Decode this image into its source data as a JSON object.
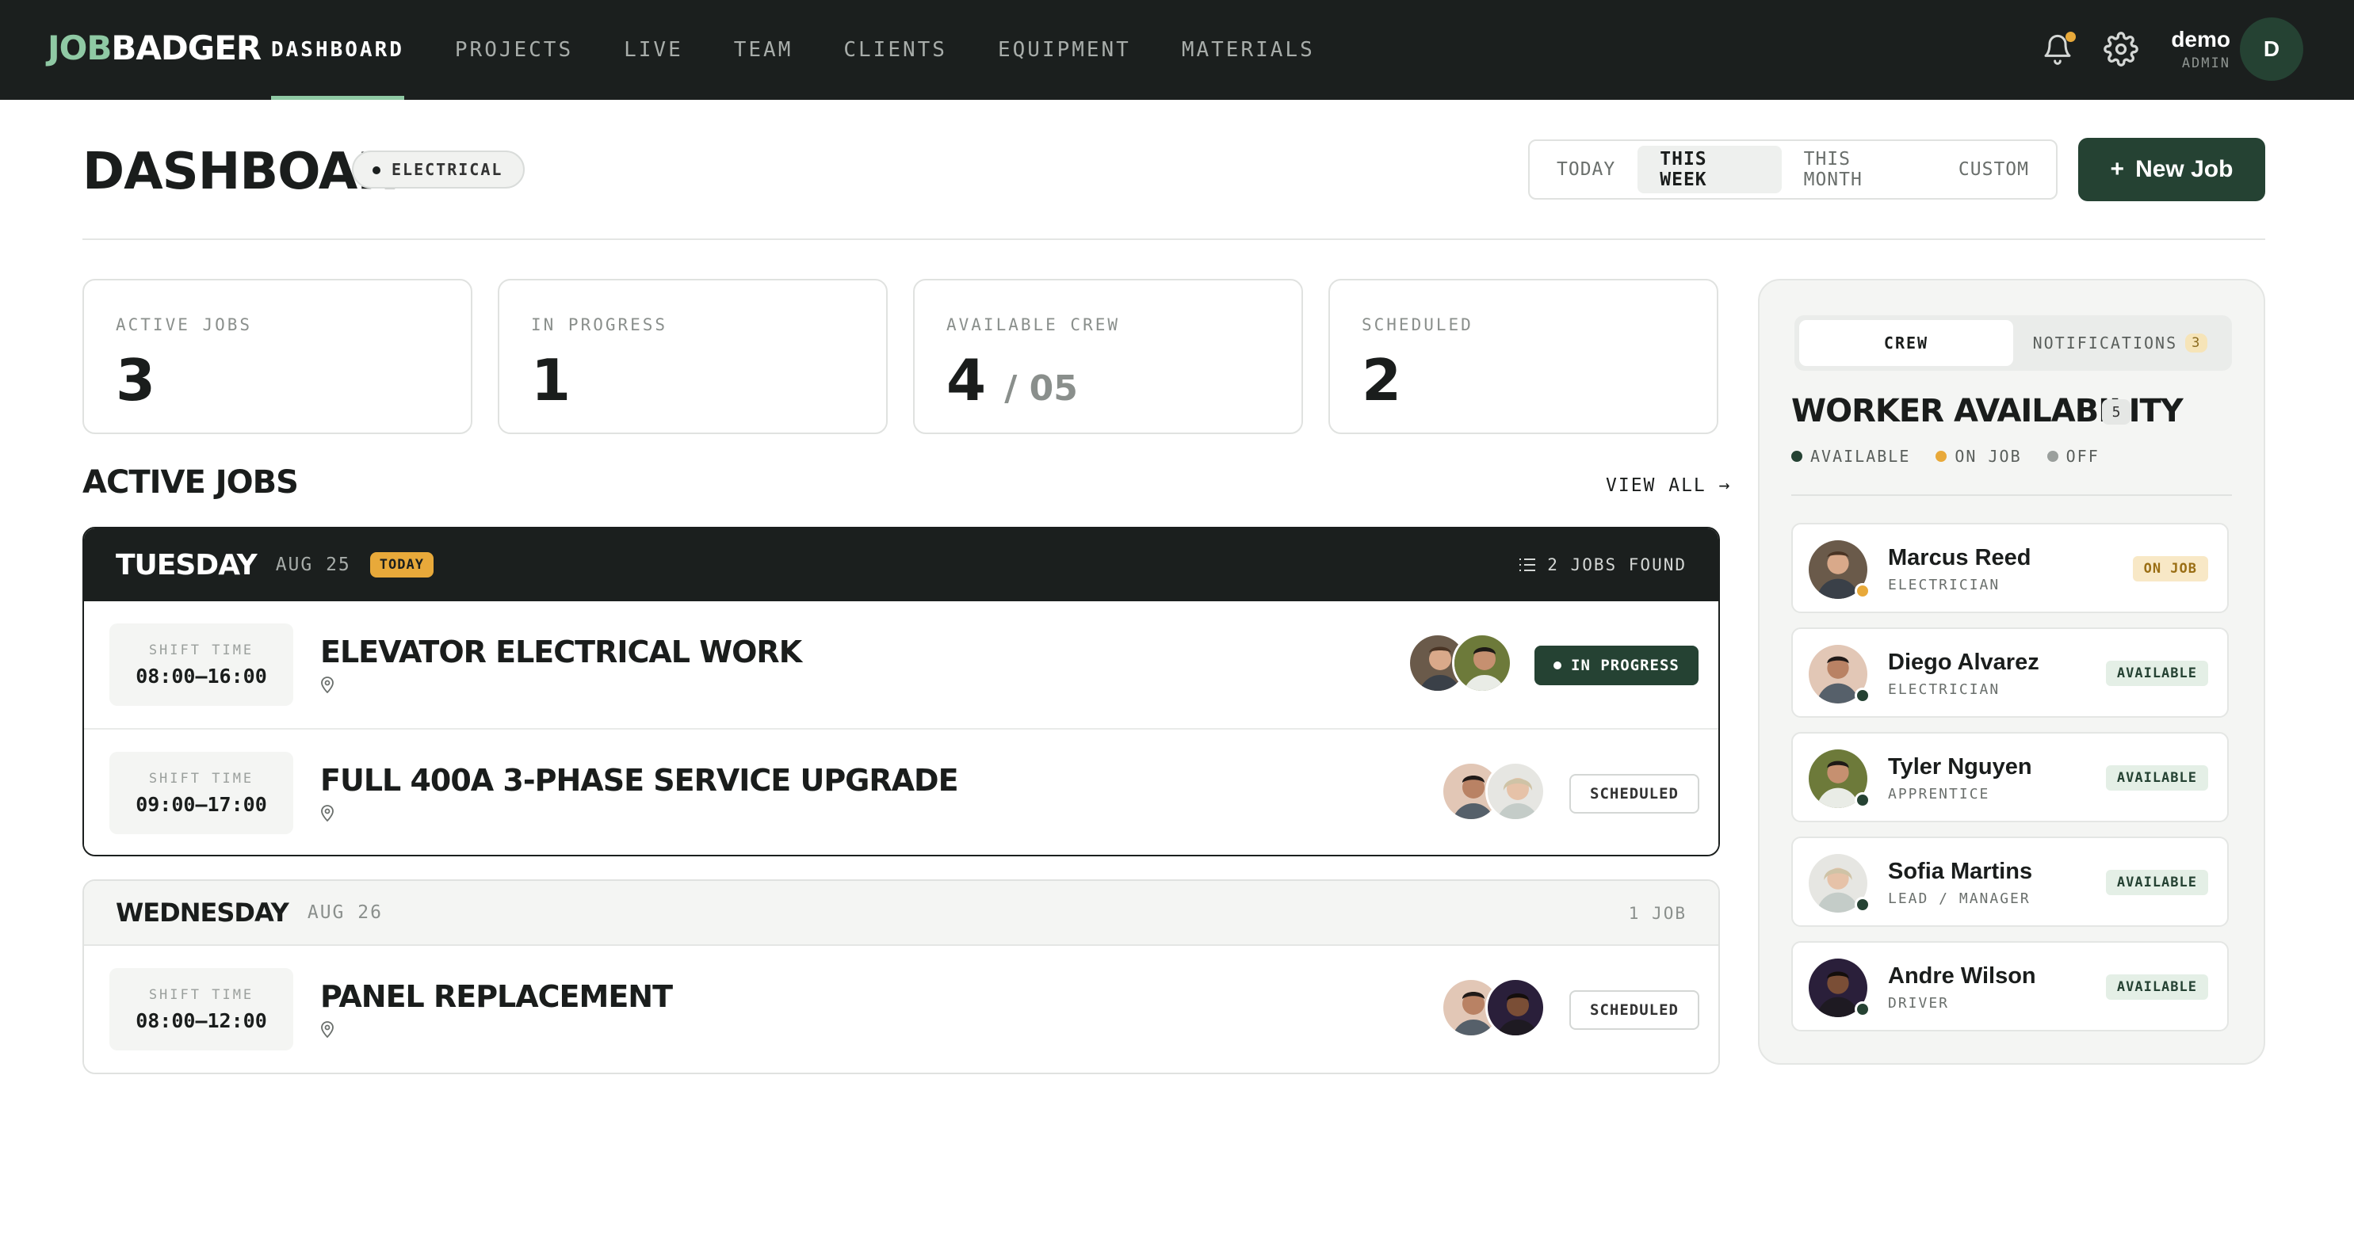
{
  "brand": {
    "part1": "JOB",
    "part2": "BADGER"
  },
  "nav": [
    {
      "label": "DASHBOARD",
      "active": true
    },
    {
      "label": "PROJECTS"
    },
    {
      "label": "LIVE"
    },
    {
      "label": "TEAM"
    },
    {
      "label": "CLIENTS"
    },
    {
      "label": "EQUIPMENT"
    },
    {
      "label": "MATERIALS"
    }
  ],
  "user": {
    "name": "demo",
    "role": "ADMIN",
    "initial": "D"
  },
  "colors": {
    "dark": "#1b1f1e",
    "accent": "#254233",
    "brand_light": "#8fc9a4",
    "warning": "#e8a93a"
  },
  "header": {
    "title": "DASHBOARD",
    "trade": "ELECTRICAL",
    "ranges": [
      "TODAY",
      "THIS WEEK",
      "THIS MONTH",
      "CUSTOM"
    ],
    "active_range": "THIS WEEK",
    "new_job": "New Job"
  },
  "stats": [
    {
      "label": "ACTIVE JOBS",
      "value": "3"
    },
    {
      "label": "IN PROGRESS",
      "value": "1"
    },
    {
      "label": "AVAILABLE CREW",
      "value": "4",
      "sub": "/ 05"
    },
    {
      "label": "SCHEDULED",
      "value": "2"
    }
  ],
  "active_jobs": {
    "title": "ACTIVE JOBS",
    "view_all": "VIEW ALL →",
    "days": [
      {
        "day": "TUESDAY",
        "date": "AUG 25",
        "badge": "TODAY",
        "found": "2 JOBS FOUND",
        "jobs": [
          {
            "shift_label": "SHIFT TIME",
            "time": "08:00–16:00",
            "title": "ELEVATOR ELECTRICAL WORK",
            "status": "IN PROGRESS"
          },
          {
            "shift_label": "SHIFT TIME",
            "time": "09:00–17:00",
            "title": "FULL 400A 3-PHASE SERVICE UPGRADE",
            "status": "SCHEDULED"
          }
        ]
      },
      {
        "day": "WEDNESDAY",
        "date": "AUG 26",
        "found": "1 JOB",
        "jobs": [
          {
            "shift_label": "SHIFT TIME",
            "time": "08:00–12:00",
            "title": "PANEL REPLACEMENT",
            "status": "SCHEDULED"
          }
        ]
      }
    ]
  },
  "panel": {
    "tabs": [
      "CREW",
      "NOTIFICATIONS"
    ],
    "notif_count": "3",
    "title": "WORKER AVAILABILITY",
    "count": "5",
    "legend": [
      "AVAILABLE",
      "ON JOB",
      "OFF"
    ],
    "workers": [
      {
        "name": "Marcus Reed",
        "role": "ELECTRICIAN",
        "status": "ON JOB"
      },
      {
        "name": "Diego Alvarez",
        "role": "ELECTRICIAN",
        "status": "AVAILABLE"
      },
      {
        "name": "Tyler Nguyen",
        "role": "APPRENTICE",
        "status": "AVAILABLE"
      },
      {
        "name": "Sofia Martins",
        "role": "LEAD / MANAGER",
        "status": "AVAILABLE"
      },
      {
        "name": "Andre Wilson",
        "role": "DRIVER",
        "status": "AVAILABLE"
      }
    ]
  }
}
